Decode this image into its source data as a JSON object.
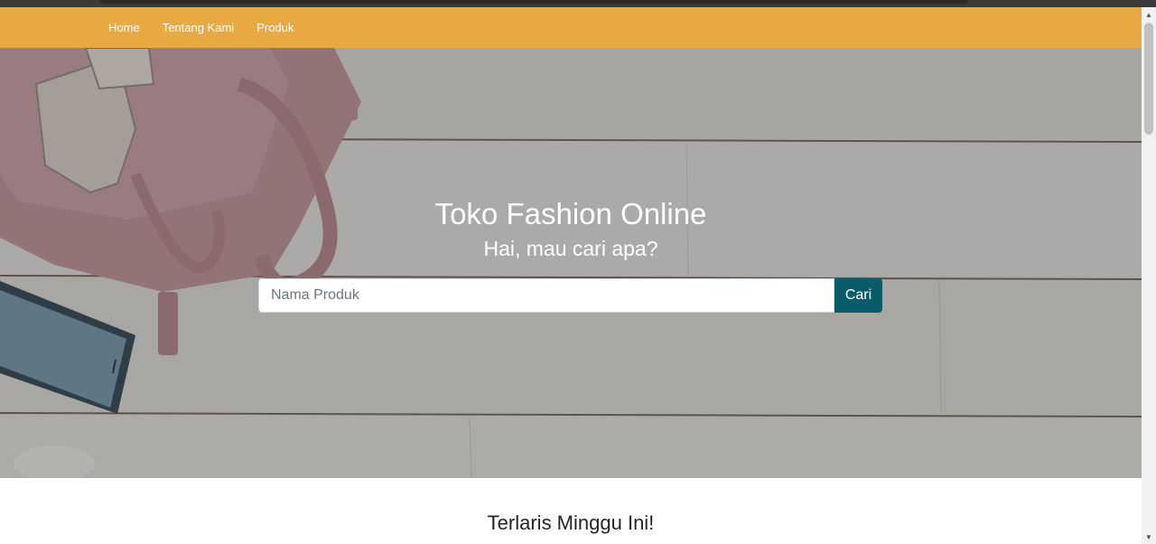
{
  "navbar": {
    "items": [
      {
        "label": "Home"
      },
      {
        "label": "Tentang Kami"
      },
      {
        "label": "Produk"
      }
    ],
    "background": "#e8a942"
  },
  "hero": {
    "title": "Toko Fashion Online",
    "subtitle": "Hai, mau cari apa?",
    "search": {
      "placeholder": "Nama Produk",
      "value": "",
      "button_label": "Cari",
      "button_color": "#0b5c6a"
    }
  },
  "section": {
    "title": "Terlaris Minggu Ini!"
  },
  "scrollbar": {
    "up_icon": "triangle-up",
    "down_icon": "triangle-down"
  }
}
